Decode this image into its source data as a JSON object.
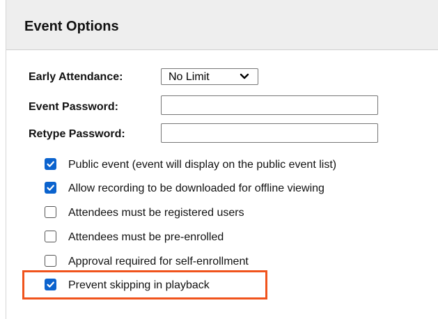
{
  "header": {
    "title": "Event Options"
  },
  "form": {
    "early_attendance": {
      "label": "Early Attendance:",
      "value": "No Limit",
      "icon": "chevron-down-icon"
    },
    "event_password": {
      "label": "Event Password:",
      "value": ""
    },
    "retype_password": {
      "label": "Retype Password:",
      "value": ""
    }
  },
  "options": [
    {
      "label": "Public event (event will display on the public event list)",
      "checked": true
    },
    {
      "label": "Allow recording to be downloaded for offline viewing",
      "checked": true
    },
    {
      "label": "Attendees must be registered users",
      "checked": false
    },
    {
      "label": "Attendees must be pre-enrolled",
      "checked": false
    },
    {
      "label": "Approval required for self-enrollment",
      "checked": false
    },
    {
      "label": "Prevent skipping in playback",
      "checked": true,
      "highlighted": true
    }
  ],
  "colors": {
    "checkbox_checked": "#0b63ce",
    "highlight": "#f0531c",
    "header_bg": "#eeeeee"
  }
}
